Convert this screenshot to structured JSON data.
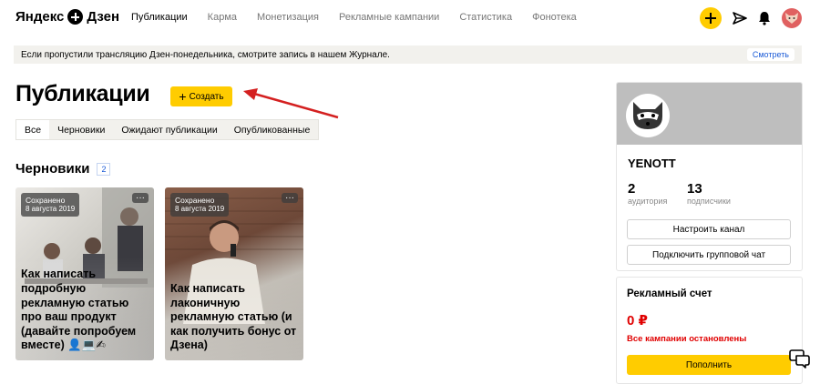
{
  "header": {
    "logo_left": "Яндекс",
    "logo_right": "Дзен",
    "nav": [
      "Публикации",
      "Карма",
      "Монетизация",
      "Рекламные кампании",
      "Статистика",
      "Фонотека"
    ],
    "active_nav": "Публикации",
    "icons": [
      "plus-icon",
      "send-icon",
      "bell-icon",
      "avatar"
    ]
  },
  "banner": {
    "text": "Если пропустили трансляцию Дзен-понедельника, смотрите запись в нашем Журнале.",
    "button": "Смотреть"
  },
  "page": {
    "title": "Публикации",
    "create_label": "Создать"
  },
  "tabs": [
    "Все",
    "Черновики",
    "Ожидают публикации",
    "Опубликованные"
  ],
  "drafts": {
    "title": "Черновики",
    "count": "2",
    "cards": [
      {
        "status": "Сохранено",
        "date": "8 августа 2019",
        "more": "···",
        "title": "Как написать подробную рекламную статью про ваш продукт (давайте попробуем вместе) 👤💻✍"
      },
      {
        "status": "Сохранено",
        "date": "8 августа 2019",
        "more": "···",
        "title": "Как написать лаконичную рекламную статью (и как получить бонус от Дзена)"
      }
    ]
  },
  "channel": {
    "name": "YENOTT",
    "audience_value": "2",
    "audience_label": "аудитория",
    "subscribers_value": "13",
    "subscribers_label": "подписчики",
    "configure_button": "Настроить канал",
    "group_chat_button": "Подключить групповой чат"
  },
  "account": {
    "title": "Рекламный счет",
    "balance": "0 ₽",
    "status": "Все кампании остановлены",
    "topup_button": "Пополнить"
  },
  "colors": {
    "accent": "#ffcc00",
    "link": "#1a5ad6",
    "danger": "#e00000",
    "arrow": "#d42020"
  }
}
